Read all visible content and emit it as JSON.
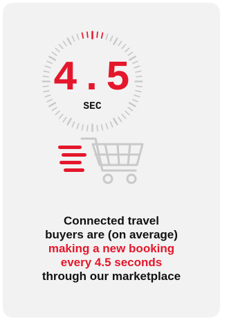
{
  "colors": {
    "accent": "#e4172b",
    "text": "#111111",
    "card_background": "#f2f2f2",
    "muted": "#c9c9c9"
  },
  "timer": {
    "value": "4.5",
    "unit": "SEC"
  },
  "icons": {
    "timer": "stopwatch-dial-icon",
    "cart": "speeding-shopping-cart-icon"
  },
  "statement": {
    "line1": "Connected travel",
    "line2": "buyers are (on average)",
    "line3": "making a new booking",
    "line4": "every 4.5 seconds",
    "line5": "through our marketplace"
  }
}
